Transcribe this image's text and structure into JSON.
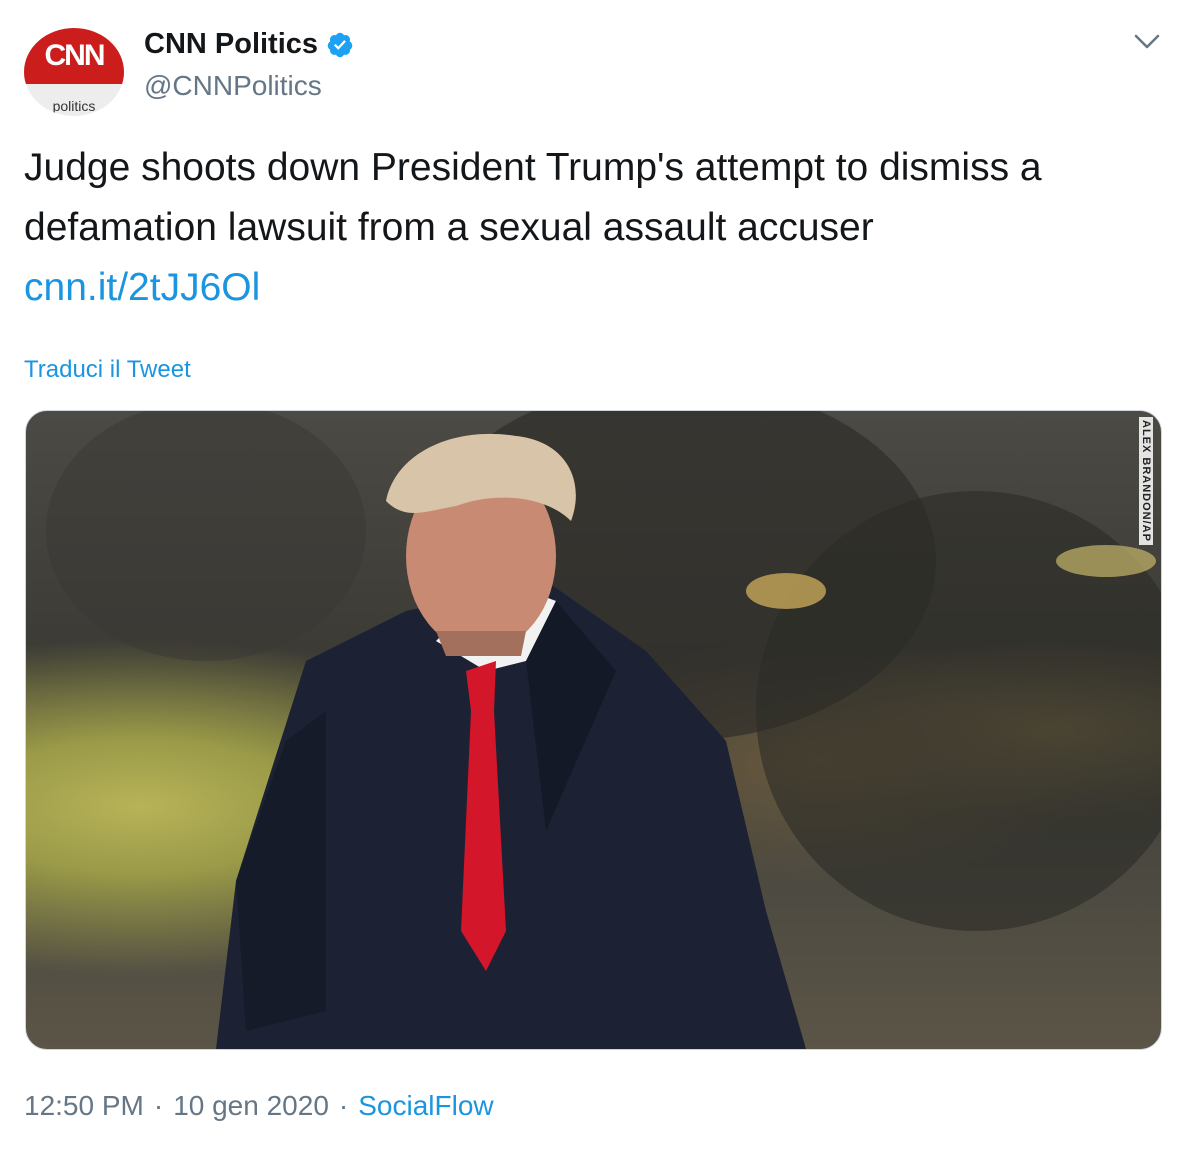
{
  "author": {
    "display_name": "CNN Politics",
    "handle": "@CNNPolitics",
    "avatar_logo_text": "CNN",
    "avatar_sub_text": "politics",
    "verified_icon": "verified-badge-icon",
    "brand_color": "#cc1d1d"
  },
  "tweet": {
    "text": "Judge shoots down President Trump's attempt to dismiss a defamation lawsuit from a sexual assault accuser",
    "link_text": "cnn.it/2tJJ6Ol",
    "translate_label": "Traduci il Tweet",
    "media_credit": "ALEX BRANDON/AP"
  },
  "meta": {
    "time": "12:50 PM",
    "separator": "·",
    "date": "10 gen 2020",
    "source": "SocialFlow"
  },
  "colors": {
    "link": "#1b95e0",
    "secondary_text": "#657786",
    "primary_text": "#14171a"
  }
}
